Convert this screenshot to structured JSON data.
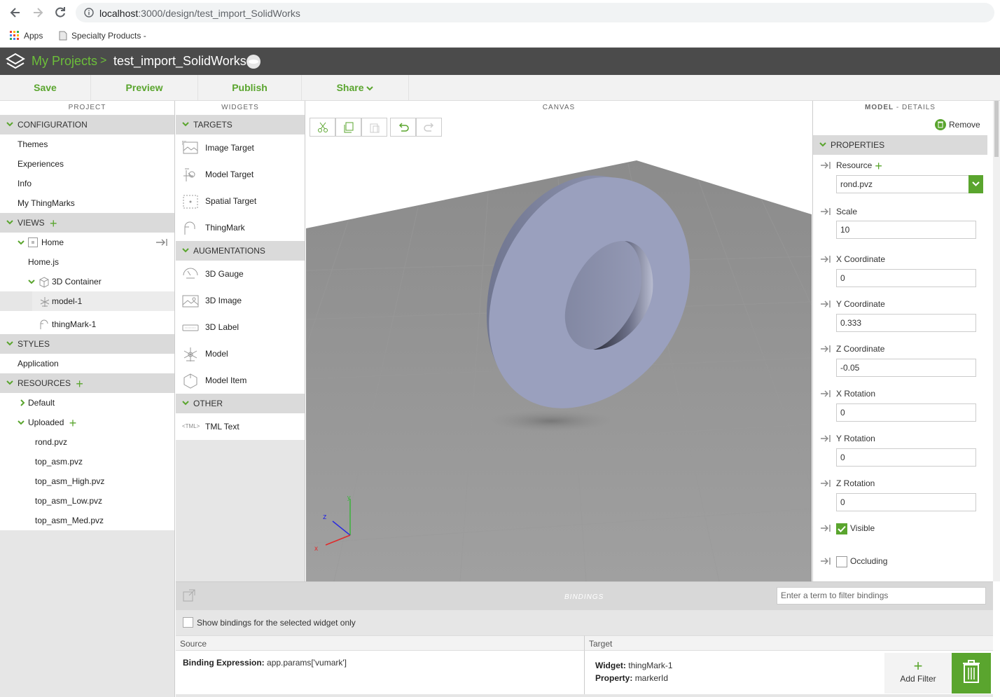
{
  "browser": {
    "url_host": "localhost",
    "url_path": ":3000/design/test_import_SolidWorks",
    "bookmarks": [
      {
        "label": "Apps",
        "icon": "apps-grid-icon"
      },
      {
        "label": "Specialty Products -",
        "icon": "page-icon"
      }
    ]
  },
  "header": {
    "breadcrumb_root": "My Projects",
    "breadcrumb_sep": ">",
    "project_name": "test_import_SolidWorks"
  },
  "toolbar": {
    "save": "Save",
    "preview": "Preview",
    "publish": "Publish",
    "share": "Share"
  },
  "project_panel": {
    "title": "PROJECT",
    "configuration": {
      "label": "CONFIGURATION",
      "items": [
        "Themes",
        "Experiences",
        "Info",
        "My ThingMarks"
      ]
    },
    "views": {
      "label": "VIEWS",
      "home": "Home",
      "home_js": "Home.js",
      "container": "3D Container",
      "model": "model-1",
      "thingmark": "thingMark-1"
    },
    "styles": {
      "label": "STYLES",
      "items": [
        "Application"
      ]
    },
    "resources": {
      "label": "RESOURCES",
      "default": "Default",
      "uploaded": "Uploaded",
      "files": [
        "rond.pvz",
        "top_asm.pvz",
        "top_asm_High.pvz",
        "top_asm_Low.pvz",
        "top_asm_Med.pvz"
      ]
    }
  },
  "widgets_panel": {
    "title": "WIDGETS",
    "targets": {
      "label": "TARGETS",
      "items": [
        "Image Target",
        "Model Target",
        "Spatial Target",
        "ThingMark"
      ]
    },
    "augmentations": {
      "label": "AUGMENTATIONS",
      "items": [
        "3D Gauge",
        "3D Image",
        "3D Label",
        "Model",
        "Model Item"
      ]
    },
    "other": {
      "label": "OTHER",
      "items": [
        "TML Text"
      ],
      "tml_icon_text": "<TML>"
    }
  },
  "canvas": {
    "title": "CANVAS",
    "axes": {
      "x": "x",
      "y": "y",
      "z": "z"
    }
  },
  "details_panel": {
    "title_bold": "MODEL",
    "title_rest": " - DETAILS",
    "remove": "Remove",
    "properties_label": "PROPERTIES",
    "resource": {
      "label": "Resource",
      "value": "rond.pvz"
    },
    "scale": {
      "label": "Scale",
      "value": "10"
    },
    "x_coord": {
      "label": "X Coordinate",
      "value": "0"
    },
    "y_coord": {
      "label": "Y Coordinate",
      "value": "0.333"
    },
    "z_coord": {
      "label": "Z Coordinate",
      "value": "-0.05"
    },
    "x_rot": {
      "label": "X Rotation",
      "value": "0"
    },
    "y_rot": {
      "label": "Y Rotation",
      "value": "0"
    },
    "z_rot": {
      "label": "Z Rotation",
      "value": "0"
    },
    "visible": {
      "label": "Visible",
      "checked": true
    },
    "occluding": {
      "label": "Occluding",
      "checked": false
    }
  },
  "bindings": {
    "title": "BINDINGS",
    "filter_placeholder": "Enter a term to filter bindings",
    "show_selected_only": "Show bindings for the selected widget only",
    "source_header": "Source",
    "target_header": "Target",
    "expr_label": "Binding Expression:",
    "expr_value": "app.params['vumark']",
    "widget_label": "Widget:",
    "widget_value": "thingMark-1",
    "property_label": "Property:",
    "property_value": "markerId",
    "add_filter": "Add Filter"
  },
  "colors": {
    "accent_green": "#5aa52e",
    "header_bg": "#4b4b4b",
    "section_bg": "#dadada",
    "model_color": "#9aa0be"
  }
}
